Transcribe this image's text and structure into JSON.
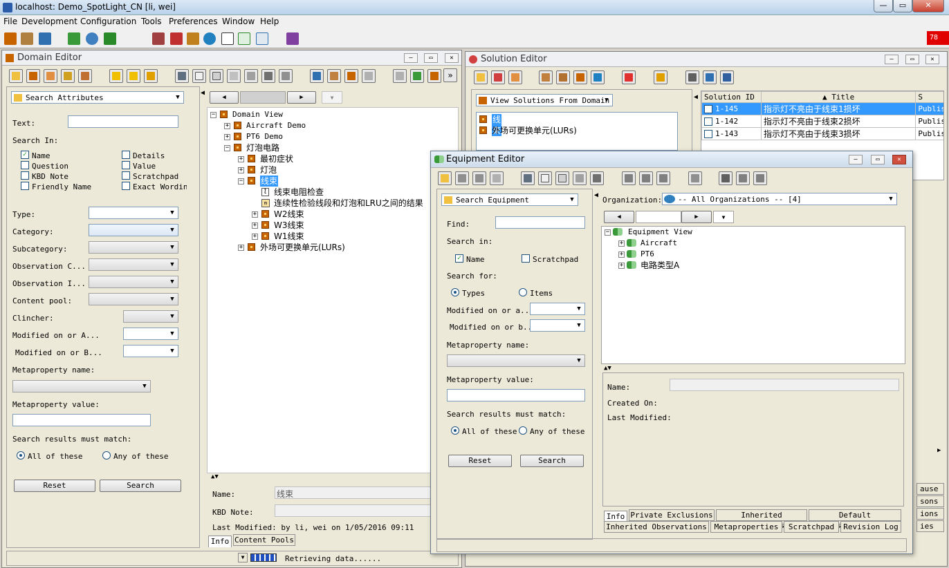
{
  "app": {
    "title": "localhost: Demo_SpotLight_CN  [li, wei]",
    "status_badge": "78"
  },
  "menu": [
    "File",
    "Development",
    "Configuration",
    "Tools",
    "Preferences",
    "Window",
    "Help"
  ],
  "domain_editor": {
    "title": "Domain Editor",
    "search_mode": "Search Attributes",
    "text_label": "Text:",
    "search_in_label": "Search In:",
    "checks": [
      {
        "label": "Name",
        "checked": true
      },
      {
        "label": "Details",
        "checked": false
      },
      {
        "label": "Question",
        "checked": false
      },
      {
        "label": "Value",
        "checked": false
      },
      {
        "label": "KBD Note",
        "checked": false
      },
      {
        "label": "Scratchpad",
        "checked": false
      },
      {
        "label": "Friendly Name",
        "checked": false
      },
      {
        "label": "Exact Wording",
        "checked": false
      }
    ],
    "type_label": "Type:",
    "category_label": "Category:",
    "subcategory_label": "Subcategory:",
    "obs_c_label": "Observation C...",
    "obs_i_label": "Observation I...",
    "content_pool_label": "Content pool:",
    "clincher_label": "Clincher:",
    "mod_a_label": "Modified on or A...",
    "mod_b_label": "Modified on or B...",
    "meta_name_label": "Metaproperty name:",
    "meta_value_label": "Metaproperty value:",
    "must_match_label": "Search results must match:",
    "all_label": "All of these",
    "any_label": "Any of these",
    "reset": "Reset",
    "search": "Search",
    "tree": {
      "root": "Domain View",
      "n1": "Aircraft Demo",
      "n2": "PT6 Demo",
      "n3": "灯泡电路",
      "n3a": "最初症状",
      "n3b": "灯泡",
      "n3c": "线束",
      "n3c1": "线束电阻检查",
      "n3c2": "连续性检验线段和灯泡和LRU之间的结果",
      "n3d": "W2线束",
      "n3e": "W3线束",
      "n3f": "W1线束",
      "n4": "外场可更换单元(LURs)"
    },
    "detail": {
      "name_label": "Name:",
      "name_value": "线束",
      "kbd_label": "KBD Note:",
      "last_modified": "Last Modified: by li, wei on 1/05/2016 09:11",
      "tab_info": "Info",
      "tab_pools": "Content Pools",
      "status": "Retrieving data......"
    }
  },
  "solution_editor": {
    "title": "Solution Editor",
    "view_label": "View Solutions From Domain",
    "list": [
      "线束",
      "外场可更换单元(LURs)"
    ],
    "columns": [
      "Solution ID",
      "Title",
      "S"
    ],
    "rows": [
      {
        "id": "1-145",
        "title": "指示灯不亮由于线束1损坏",
        "s": "Publis"
      },
      {
        "id": "1-142",
        "title": "指示灯不亮由于线束2损坏",
        "s": "Publis"
      },
      {
        "id": "1-143",
        "title": "指示灯不亮由于线束3损坏",
        "s": "Publis"
      }
    ],
    "side_tabs": [
      "ause",
      "sons",
      "ions",
      "ies"
    ]
  },
  "equipment_editor": {
    "title": "Equipment Editor",
    "search_mode": "Search Equipment",
    "find_label": "Find:",
    "search_in_label": "Search in:",
    "name_label": "Name",
    "scratchpad_label": "Scratchpad",
    "search_for_label": "Search for:",
    "types_label": "Types",
    "items_label": "Items",
    "mod_a_label": "Modified on or a...",
    "mod_b_label": "Modified on or b...",
    "meta_name_label": "Metaproperty name:",
    "meta_value_label": "Metaproperty value:",
    "must_match_label": "Search results must match:",
    "all_label": "All of these",
    "any_label": "Any of these",
    "reset": "Reset",
    "search": "Search",
    "org_label": "Organization:",
    "org_value": "-- All Organizations --     [4]",
    "tree": {
      "root": "Equipment View",
      "n1": "Aircraft",
      "n2": "PT6",
      "n3": "电路类型A"
    },
    "detail": {
      "name_label": "Name:",
      "created_label": "Created On:",
      "modified_label": "Last Modified:"
    },
    "tabs_row1": [
      "Info",
      "Private Exclusions",
      "Inherited Exclusions",
      "Default Observations"
    ],
    "tabs_row2": [
      "Inherited Observations",
      "Metaproperties",
      "Scratchpad",
      "Revision Log"
    ]
  }
}
